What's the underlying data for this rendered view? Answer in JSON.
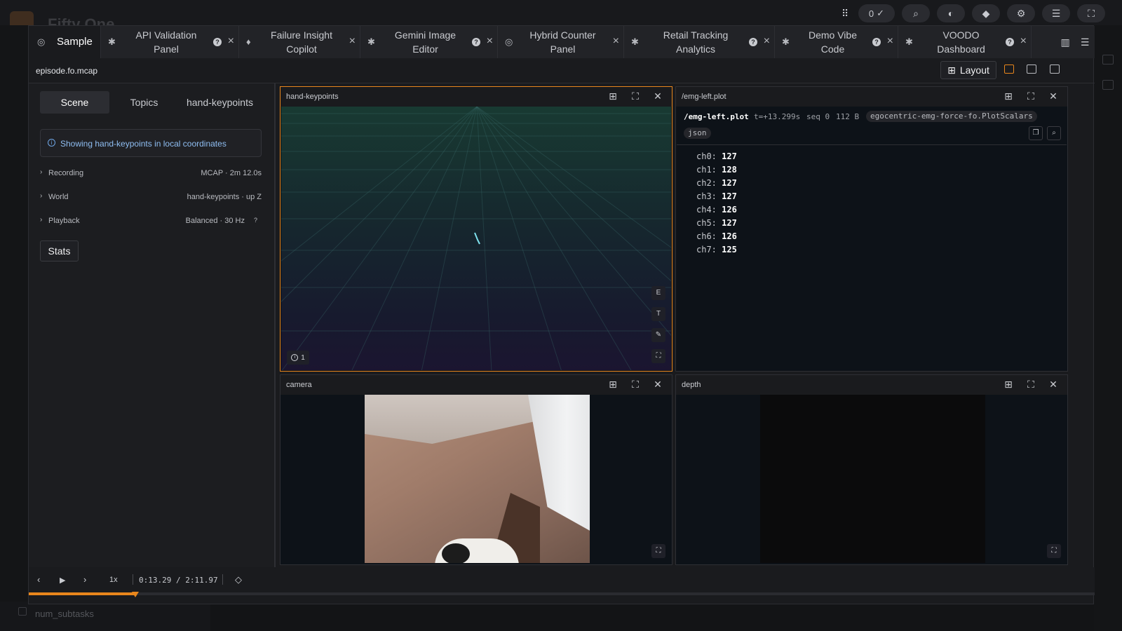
{
  "background": {
    "app_title": "Fifty One",
    "bottom_label": "num_subtasks"
  },
  "toolbar": {
    "count": "0"
  },
  "tabs": [
    {
      "label": "Sample",
      "icon": "target-icon",
      "active": true
    },
    {
      "label": "API Validation Panel",
      "icon": "puzzle-icon"
    },
    {
      "label": "Failure Insight Copilot",
      "icon": "lightbulb-icon"
    },
    {
      "label": "Gemini Image Editor",
      "icon": "puzzle-icon"
    },
    {
      "label": "Hybrid Counter Panel",
      "icon": "target-icon"
    },
    {
      "label": "Retail Tracking Analytics",
      "icon": "puzzle-icon"
    },
    {
      "label": "Demo Vibe Code",
      "icon": "puzzle-icon"
    },
    {
      "label": "VOODO Dashboard",
      "icon": "puzzle-icon"
    }
  ],
  "file": {
    "name": "episode.fo.mcap",
    "layout_label": "Layout"
  },
  "left_panel": {
    "tabs": [
      "Scene",
      "Topics",
      "hand-keypoints"
    ],
    "info": "Showing hand-keypoints in local coordinates",
    "rows": [
      {
        "label": "Recording",
        "value": "MCAP · 2m 12.0s"
      },
      {
        "label": "World",
        "value": "hand-keypoints · up Z"
      },
      {
        "label": "Playback",
        "value": "Balanced · 30 Hz",
        "help": "?"
      }
    ],
    "stats_label": "Stats"
  },
  "panels": {
    "hand_keypoints": {
      "title": "hand-keypoints",
      "tools": [
        "E",
        "T"
      ],
      "badge_count": "1"
    },
    "emg": {
      "title": "/emg-left.plot",
      "topic": "/emg-left.plot",
      "time": "t=+13.299s",
      "seq": "seq 0",
      "size": "112 B",
      "schema": "egocentric-emg-force-fo.PlotScalars",
      "format": "json",
      "values": [
        {
          "key": "ch0:",
          "value": "127"
        },
        {
          "key": "ch1:",
          "value": "128"
        },
        {
          "key": "ch2:",
          "value": "127"
        },
        {
          "key": "ch3:",
          "value": "127"
        },
        {
          "key": "ch4:",
          "value": "126"
        },
        {
          "key": "ch5:",
          "value": "127"
        },
        {
          "key": "ch6:",
          "value": "126"
        },
        {
          "key": "ch7:",
          "value": "125"
        }
      ]
    },
    "camera": {
      "title": "camera"
    },
    "depth": {
      "title": "depth"
    }
  },
  "playback": {
    "speed": "1x",
    "time": "0:13.29 / 2:11.97",
    "progress": 0.1
  },
  "colors": {
    "accent": "#e8861c",
    "info": "#8fbef2"
  }
}
